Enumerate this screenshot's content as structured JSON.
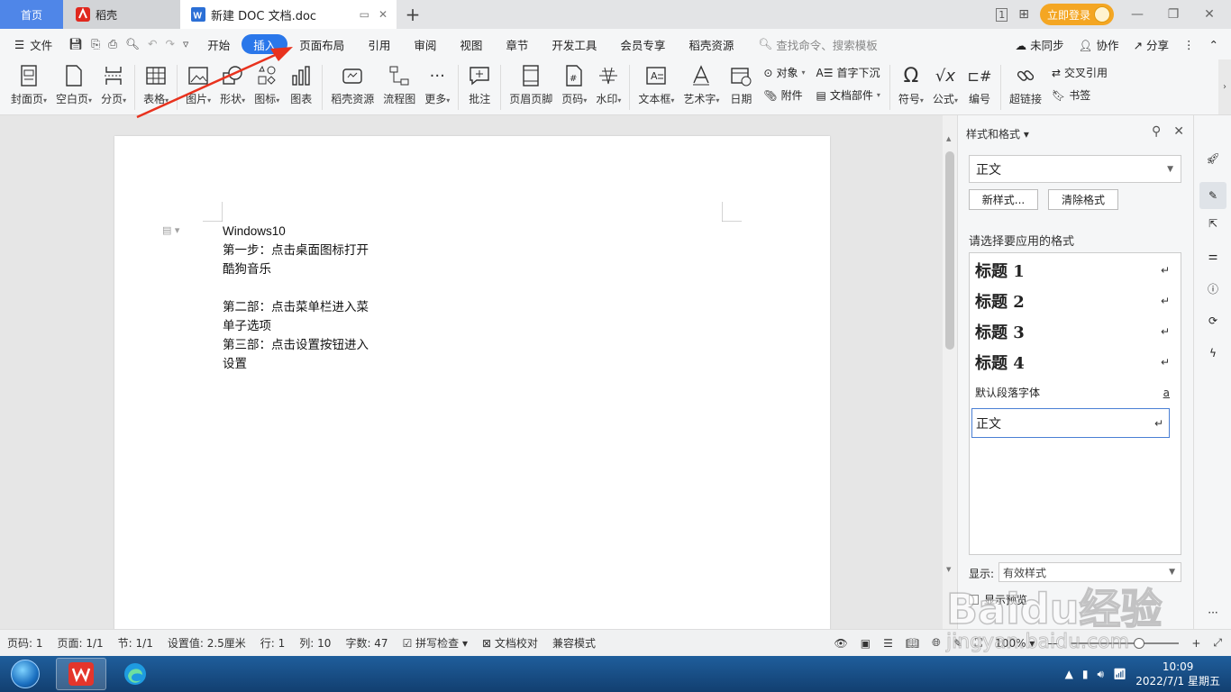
{
  "titlebar": {
    "home_tab": "首页",
    "shell_tab": "稻壳",
    "doc_tab": "新建 DOC 文档.doc",
    "login_button": "立即登录",
    "layout_badge": "1"
  },
  "menubar": {
    "file": "文件",
    "tabs": [
      "开始",
      "插入",
      "页面布局",
      "引用",
      "审阅",
      "视图",
      "章节",
      "开发工具",
      "会员专享",
      "稻壳资源"
    ],
    "active_tab": "插入",
    "search_placeholder": "查找命令、搜索模板",
    "sync": "未同步",
    "collab": "协作",
    "share": "分享"
  },
  "ribbon": {
    "cover": "封面页",
    "blank": "空白页",
    "pagebreak": "分页",
    "table": "表格",
    "picture": "图片",
    "shape": "形状",
    "iconlib": "图标",
    "chart": "图表",
    "docer_res": "稻壳资源",
    "flowchart": "流程图",
    "more": "更多",
    "comment": "批注",
    "header_footer": "页眉页脚",
    "page_num": "页码",
    "watermark": "水印",
    "textbox": "文本框",
    "wordart": "艺术字",
    "date": "日期",
    "object": "对象",
    "attachment": "附件",
    "dropcap": "首字下沉",
    "docpart": "文档部件",
    "symbol": "符号",
    "formula": "公式",
    "numbering": "编号",
    "hyperlink": "超链接",
    "crossref": "交叉引用",
    "bookmark": "书签"
  },
  "document": {
    "lines": [
      "Windows10",
      "第一步：点击桌面图标打开",
      "酷狗音乐",
      "",
      "第二部：点击菜单栏进入菜",
      "单子选项",
      "第三部：点击设置按钮进入",
      "设置"
    ]
  },
  "style_panel": {
    "title": "样式和格式",
    "current_style": "正文",
    "new_style": "新样式...",
    "clear_format": "清除格式",
    "apply_label": "请选择要应用的格式",
    "styles": [
      "标题 1",
      "标题 2",
      "标题 3",
      "标题 4",
      "默认段落字体",
      "正文"
    ],
    "show_label": "显示:",
    "show_value": "有效样式",
    "preview_label": "显示预览"
  },
  "statusbar": {
    "page_code": "页码: 1",
    "pages": "页面: 1/1",
    "section": "节: 1/1",
    "setting": "设置值: 2.5厘米",
    "row": "行: 1",
    "col": "列: 10",
    "words": "字数: 47",
    "spellcheck": "拼写检查",
    "doc_check": "文档校对",
    "compat": "兼容模式",
    "zoom": "100%"
  },
  "taskbar": {
    "time": "10:09",
    "date": "2022/7/1 星期五"
  },
  "watermark_text": "Baidu经验",
  "watermark_url": "jingyan.baidu.com",
  "colors": {
    "accent": "#2a77ea",
    "home_tab": "#4f86e8",
    "login": "#f4a623",
    "arrow": "#e8321e"
  }
}
